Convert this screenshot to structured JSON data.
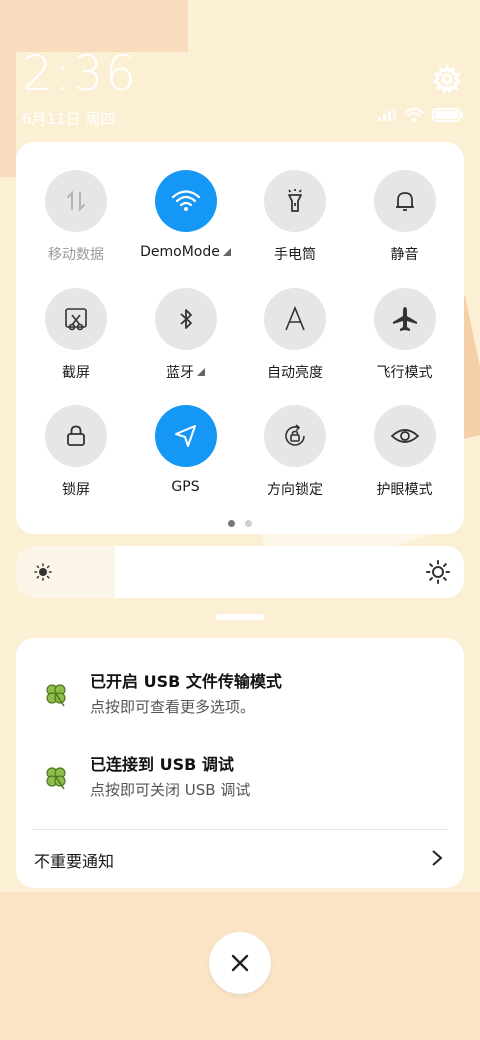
{
  "status": {
    "time": "2:36",
    "date": "6月11日 周四"
  },
  "quick_settings": {
    "tiles": [
      {
        "label": "移动数据",
        "icon": "mobile-data-icon",
        "active": false,
        "dim": true,
        "caret": false
      },
      {
        "label": "DemoMode",
        "icon": "wifi-icon",
        "active": true,
        "dim": false,
        "caret": true
      },
      {
        "label": "手电筒",
        "icon": "flashlight-icon",
        "active": false,
        "dim": false,
        "caret": false
      },
      {
        "label": "静音",
        "icon": "bell-icon",
        "active": false,
        "dim": false,
        "caret": false
      },
      {
        "label": "截屏",
        "icon": "screenshot-icon",
        "active": false,
        "dim": false,
        "caret": false
      },
      {
        "label": "蓝牙",
        "icon": "bluetooth-icon",
        "active": false,
        "dim": false,
        "caret": true
      },
      {
        "label": "自动亮度",
        "icon": "auto-brightness-icon",
        "active": false,
        "dim": false,
        "caret": false
      },
      {
        "label": "飞行模式",
        "icon": "airplane-icon",
        "active": false,
        "dim": false,
        "caret": false
      },
      {
        "label": "锁屏",
        "icon": "lock-icon",
        "active": false,
        "dim": false,
        "caret": false
      },
      {
        "label": "GPS",
        "icon": "location-arrow-icon",
        "active": true,
        "dim": false,
        "caret": false
      },
      {
        "label": "方向锁定",
        "icon": "rotation-lock-icon",
        "active": false,
        "dim": false,
        "caret": false
      },
      {
        "label": "护眼模式",
        "icon": "eye-icon",
        "active": false,
        "dim": false,
        "caret": false
      }
    ],
    "page_count": 2,
    "current_page": 1
  },
  "brightness": {
    "level": 0.22
  },
  "notifications": [
    {
      "title": "已开启 USB 文件传输模式",
      "text": "点按即可查看更多选项。",
      "icon": "clover-icon"
    },
    {
      "title": "已连接到 USB 调试",
      "text": "点按即可关闭 USB 调试",
      "icon": "clover-icon"
    }
  ],
  "unimportant_label": "不重要通知",
  "colors": {
    "accent": "#1598f5",
    "tile_inactive": "#e6e6e6",
    "wallpaper": "#fbf0d4"
  }
}
